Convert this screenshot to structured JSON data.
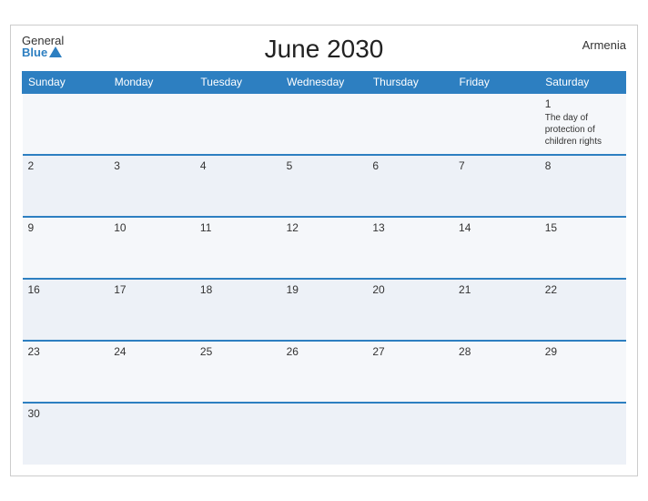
{
  "header": {
    "title": "June 2030",
    "country": "Armenia",
    "logo_general": "General",
    "logo_blue": "Blue"
  },
  "weekdays": [
    "Sunday",
    "Monday",
    "Tuesday",
    "Wednesday",
    "Thursday",
    "Friday",
    "Saturday"
  ],
  "weeks": [
    [
      {
        "day": "",
        "holiday": ""
      },
      {
        "day": "",
        "holiday": ""
      },
      {
        "day": "",
        "holiday": ""
      },
      {
        "day": "",
        "holiday": ""
      },
      {
        "day": "",
        "holiday": ""
      },
      {
        "day": "",
        "holiday": ""
      },
      {
        "day": "1",
        "holiday": "The day of protection of children rights"
      }
    ],
    [
      {
        "day": "2",
        "holiday": ""
      },
      {
        "day": "3",
        "holiday": ""
      },
      {
        "day": "4",
        "holiday": ""
      },
      {
        "day": "5",
        "holiday": ""
      },
      {
        "day": "6",
        "holiday": ""
      },
      {
        "day": "7",
        "holiday": ""
      },
      {
        "day": "8",
        "holiday": ""
      }
    ],
    [
      {
        "day": "9",
        "holiday": ""
      },
      {
        "day": "10",
        "holiday": ""
      },
      {
        "day": "11",
        "holiday": ""
      },
      {
        "day": "12",
        "holiday": ""
      },
      {
        "day": "13",
        "holiday": ""
      },
      {
        "day": "14",
        "holiday": ""
      },
      {
        "day": "15",
        "holiday": ""
      }
    ],
    [
      {
        "day": "16",
        "holiday": ""
      },
      {
        "day": "17",
        "holiday": ""
      },
      {
        "day": "18",
        "holiday": ""
      },
      {
        "day": "19",
        "holiday": ""
      },
      {
        "day": "20",
        "holiday": ""
      },
      {
        "day": "21",
        "holiday": ""
      },
      {
        "day": "22",
        "holiday": ""
      }
    ],
    [
      {
        "day": "23",
        "holiday": ""
      },
      {
        "day": "24",
        "holiday": ""
      },
      {
        "day": "25",
        "holiday": ""
      },
      {
        "day": "26",
        "holiday": ""
      },
      {
        "day": "27",
        "holiday": ""
      },
      {
        "day": "28",
        "holiday": ""
      },
      {
        "day": "29",
        "holiday": ""
      }
    ],
    [
      {
        "day": "30",
        "holiday": ""
      },
      {
        "day": "",
        "holiday": ""
      },
      {
        "day": "",
        "holiday": ""
      },
      {
        "day": "",
        "holiday": ""
      },
      {
        "day": "",
        "holiday": ""
      },
      {
        "day": "",
        "holiday": ""
      },
      {
        "day": "",
        "holiday": ""
      }
    ]
  ]
}
